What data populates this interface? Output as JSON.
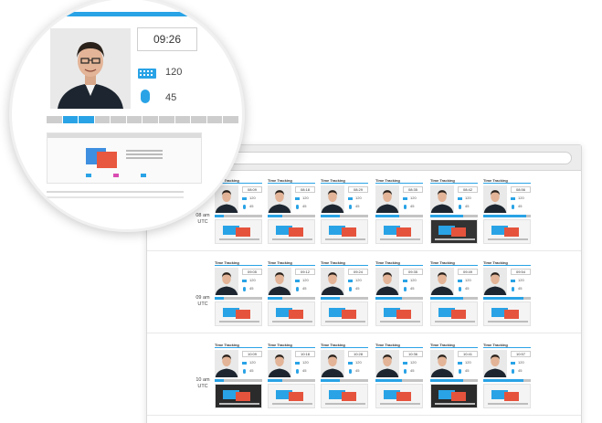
{
  "zoom": {
    "time": "09:26",
    "keyboard_count": "120",
    "mouse_count": "45",
    "icons": {
      "keyboard": "keyboard-icon",
      "mouse": "mouse-icon"
    },
    "progress_active_segments": [
      1,
      2
    ],
    "progress_total_segments": 12
  },
  "hours": [
    {
      "label": "08 am\nUTC"
    },
    {
      "label": "09 am\nUTC"
    },
    {
      "label": "10 am\nUTC"
    }
  ],
  "screens": [
    [
      {
        "title": "Time Tracking",
        "time": "08:09",
        "keys": "120",
        "clicks": "45",
        "progress": 0.2
      },
      {
        "title": "Time Tracking",
        "time": "08:18",
        "keys": "120",
        "clicks": "45",
        "progress": 0.3
      },
      {
        "title": "Time Tracking",
        "time": "08:29",
        "keys": "120",
        "clicks": "45",
        "progress": 0.4
      },
      {
        "title": "Time Tracking",
        "time": "08:35",
        "keys": "120",
        "clicks": "45",
        "progress": 0.5
      },
      {
        "title": "Time Tracking",
        "time": "08:42",
        "keys": "120",
        "clicks": "45",
        "progress": 0.7
      },
      {
        "title": "Time Tracking",
        "time": "08:56",
        "keys": "120",
        "clicks": "45",
        "progress": 0.9
      }
    ],
    [
      {
        "title": "Time Tracking",
        "time": "09:05",
        "keys": "120",
        "clicks": "45",
        "progress": 0.2
      },
      {
        "title": "Time Tracking",
        "time": "09:12",
        "keys": "120",
        "clicks": "45",
        "progress": 0.3
      },
      {
        "title": "Time Tracking",
        "time": "09:24",
        "keys": "120",
        "clicks": "45",
        "progress": 0.4
      },
      {
        "title": "Time Tracking",
        "time": "09:35",
        "keys": "120",
        "clicks": "45",
        "progress": 0.55
      },
      {
        "title": "Time Tracking",
        "time": "09:49",
        "keys": "120",
        "clicks": "45",
        "progress": 0.7
      },
      {
        "title": "Time Tracking",
        "time": "09:54",
        "keys": "120",
        "clicks": "45",
        "progress": 0.85
      }
    ],
    [
      {
        "title": "Time Tracking",
        "time": "10:09",
        "keys": "120",
        "clicks": "45",
        "progress": 0.2
      },
      {
        "title": "Time Tracking",
        "time": "10:18",
        "keys": "120",
        "clicks": "45",
        "progress": 0.3
      },
      {
        "title": "Time Tracking",
        "time": "10:28",
        "keys": "120",
        "clicks": "45",
        "progress": 0.4
      },
      {
        "title": "Time Tracking",
        "time": "10:36",
        "keys": "120",
        "clicks": "45",
        "progress": 0.55
      },
      {
        "title": "Time Tracking",
        "time": "10:41",
        "keys": "120",
        "clicks": "45",
        "progress": 0.7
      },
      {
        "title": "Time Tracking",
        "time": "10:57",
        "keys": "120",
        "clicks": "45",
        "progress": 0.85
      }
    ]
  ],
  "colors": {
    "accent": "#29a3e6",
    "muted": "#cdcdcd"
  }
}
